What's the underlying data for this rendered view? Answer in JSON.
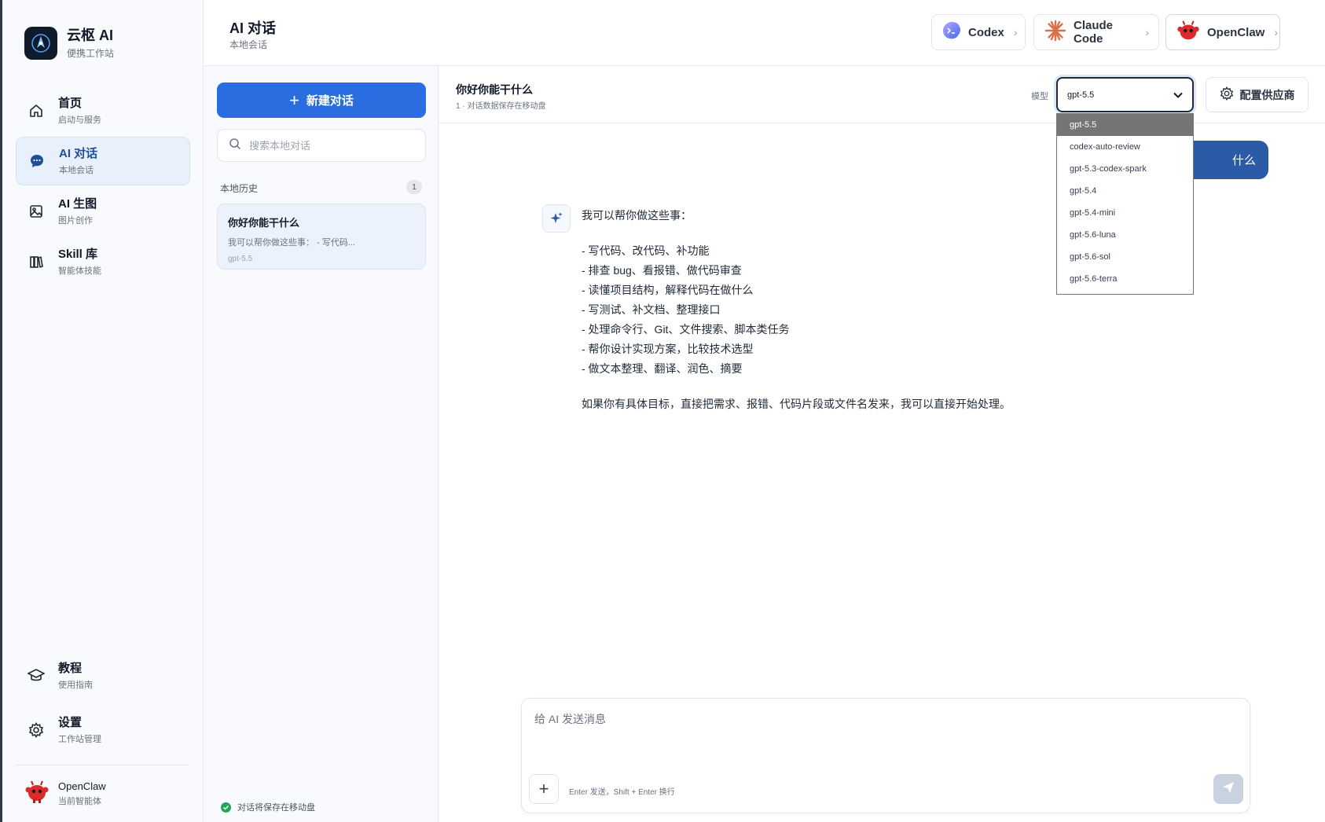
{
  "brand": {
    "title": "云枢 AI",
    "subtitle": "便携工作站"
  },
  "sidebar": {
    "items": [
      {
        "label": "首页",
        "sub": "启动与服务"
      },
      {
        "label": "AI 对话",
        "sub": "本地会话"
      },
      {
        "label": "AI 生图",
        "sub": "图片创作"
      },
      {
        "label": "Skill 库",
        "sub": "智能体技能"
      },
      {
        "label": "教程",
        "sub": "使用指南"
      },
      {
        "label": "设置",
        "sub": "工作站管理"
      }
    ],
    "agent": {
      "name": "OpenClaw",
      "sub": "当前智能体"
    }
  },
  "header": {
    "title": "AI 对话",
    "subtitle": "本地会话",
    "tools": [
      {
        "label": "Codex"
      },
      {
        "label": "Claude Code"
      },
      {
        "label": "OpenClaw"
      }
    ]
  },
  "history": {
    "new_chat_label": "新建对话",
    "search_placeholder": "搜索本地对话",
    "section_label": "本地历史",
    "count": "1",
    "items": [
      {
        "title": "你好你能干什么",
        "preview": "我可以帮你做这些事： - 写代码...",
        "model": "gpt-5.5"
      }
    ],
    "saved_note": "对话将保存在移动盘"
  },
  "chat": {
    "title": "你好你能干什么",
    "subtitle": "1 · 对话数据保存在移动盘",
    "model_label": "模型",
    "selected_model": "gpt-5.5",
    "provider_label": "配置供应商",
    "model_options": [
      "gpt-5.5",
      "codex-auto-review",
      "gpt-5.3-codex-spark",
      "gpt-5.4",
      "gpt-5.4-mini",
      "gpt-5.6-luna",
      "gpt-5.6-sol",
      "gpt-5.6-terra"
    ],
    "user_message_visible": "什么",
    "ai_message": {
      "intro": "我可以帮你做这些事：",
      "bullets": [
        "- 写代码、改代码、补功能",
        "- 排查 bug、看报错、做代码审查",
        "- 读懂项目结构，解释代码在做什么",
        "- 写测试、补文档、整理接口",
        "- 处理命令行、Git、文件搜索、脚本类任务",
        "- 帮你设计实现方案，比较技术选型",
        "- 做文本整理、翻译、润色、摘要"
      ],
      "outro": "如果你有具体目标，直接把需求、报错、代码片段或文件名发来，我可以直接开始处理。"
    },
    "composer": {
      "placeholder": "给 AI 发送消息",
      "hint": "Enter 发送，Shift + Enter 换行"
    }
  },
  "colors": {
    "accent": "#2a6de0",
    "user_bubble": "#2b5aa7",
    "active_nav_bg": "#e8f0fb",
    "success": "#22a45a"
  },
  "icons": {
    "nav": [
      "home-icon",
      "chat-icon",
      "image-icon",
      "books-icon",
      "graduation-cap-icon",
      "gear-icon"
    ],
    "tools": [
      "codex-icon",
      "claude-spark-icon",
      "openclaw-mascot-icon"
    ]
  }
}
